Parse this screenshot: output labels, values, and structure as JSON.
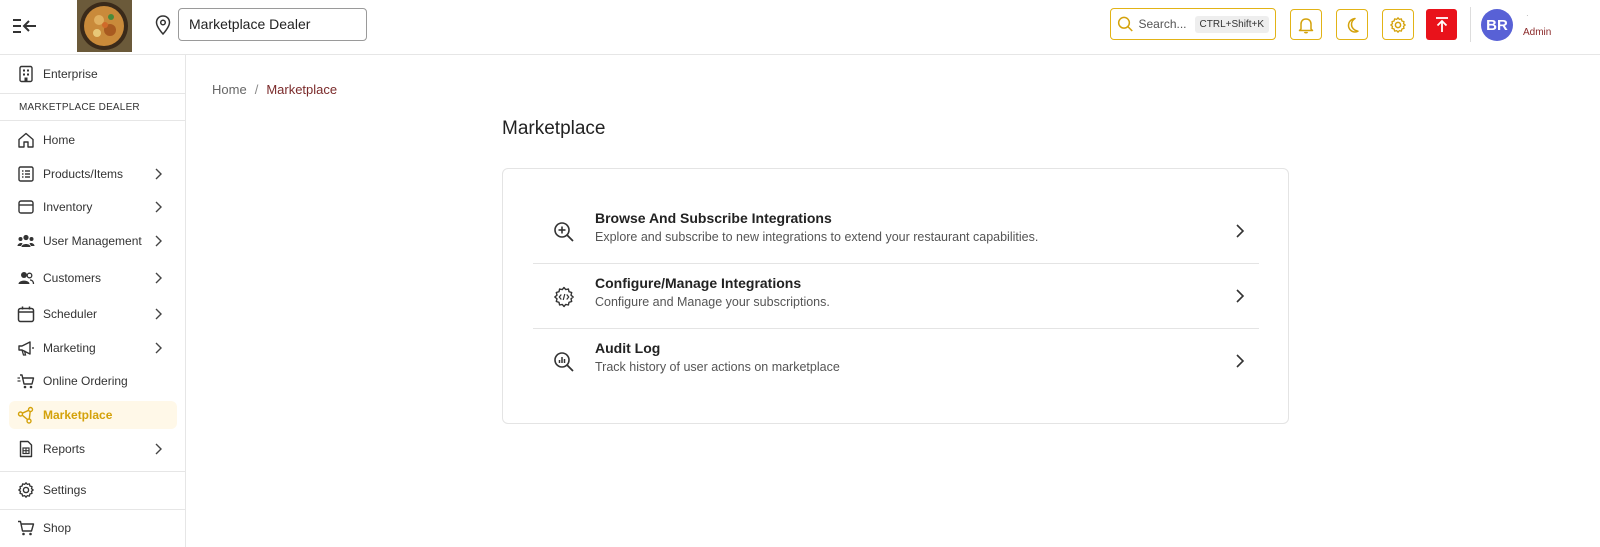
{
  "header": {
    "location_value": "Marketplace Dealer",
    "search_label": "Search...",
    "search_shortcut": "CTRL+Shift+K",
    "avatar_initials": "BR",
    "user_role": "Admin",
    "user_name": "·"
  },
  "sidebar": {
    "enterprise_label": "Enterprise",
    "section_label": "MARKETPLACE DEALER",
    "items": [
      {
        "label": "Home",
        "icon": "home-icon",
        "has_chevron": false
      },
      {
        "label": "Products/Items",
        "icon": "list-icon",
        "has_chevron": true
      },
      {
        "label": "Inventory",
        "icon": "box-icon",
        "has_chevron": true
      },
      {
        "label": "User Management",
        "icon": "users-icon",
        "has_chevron": true
      },
      {
        "label": "Customers",
        "icon": "customers-icon",
        "has_chevron": true
      },
      {
        "label": "Scheduler",
        "icon": "calendar-icon",
        "has_chevron": true
      },
      {
        "label": "Marketing",
        "icon": "megaphone-icon",
        "has_chevron": true
      },
      {
        "label": "Online Ordering",
        "icon": "cart-icon",
        "has_chevron": false
      },
      {
        "label": "Marketplace",
        "icon": "share-icon",
        "has_chevron": false,
        "active": true
      },
      {
        "label": "Reports",
        "icon": "report-icon",
        "has_chevron": true
      }
    ],
    "settings_label": "Settings",
    "shop_label": "Shop"
  },
  "breadcrumb": {
    "home": "Home",
    "separator": "/",
    "current": "Marketplace"
  },
  "page_title": "Marketplace",
  "options": [
    {
      "title": "Browse And Subscribe Integrations",
      "description": "Explore and subscribe to new integrations to extend your restaurant capabilities.",
      "icon": "zoom-in-icon"
    },
    {
      "title": "Configure/Manage Integrations",
      "description": "Configure and Manage your subscriptions.",
      "icon": "gear-code-icon"
    },
    {
      "title": "Audit Log",
      "description": "Track history of user actions on marketplace",
      "icon": "search-chart-icon"
    }
  ],
  "colors": {
    "accent": "#e2b316",
    "active_bg": "#fff8e8",
    "danger": "#e9121b",
    "avatar": "#5861d6"
  }
}
